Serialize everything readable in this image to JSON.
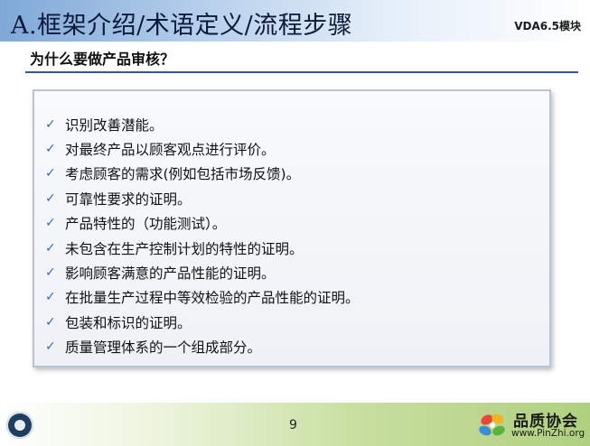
{
  "header": {
    "title": "A.框架介绍/术语定义/流程步骤",
    "module": "VDA6.5模块"
  },
  "subtitle": "为什么要做产品审核？",
  "bullets": [
    "识别改善潜能。",
    "对最终产品以顾客观点进行评价。",
    "考虑顾客的需求(例如包括市场反馈)。",
    "可靠性要求的证明。",
    "产品特性的（功能测试）。",
    "未包含在生产控制计划的特性的证明。",
    "影响顾客满意的产品性能的证明。",
    "在批量生产过程中等效检验的产品性能的证明。",
    "包装和标识的证明。",
    "质量管理体系的一个组成部分。"
  ],
  "bullet_icon": "check-icon",
  "footer": {
    "page_number": "9",
    "logo_name": "品质协会",
    "logo_url": "www.PinZhi.org"
  },
  "colors": {
    "header_gradient_start": "#7fa8d8",
    "rule": "#2f58a0",
    "check": "#3a69b0",
    "footer_gradient_end": "#b0d080"
  }
}
